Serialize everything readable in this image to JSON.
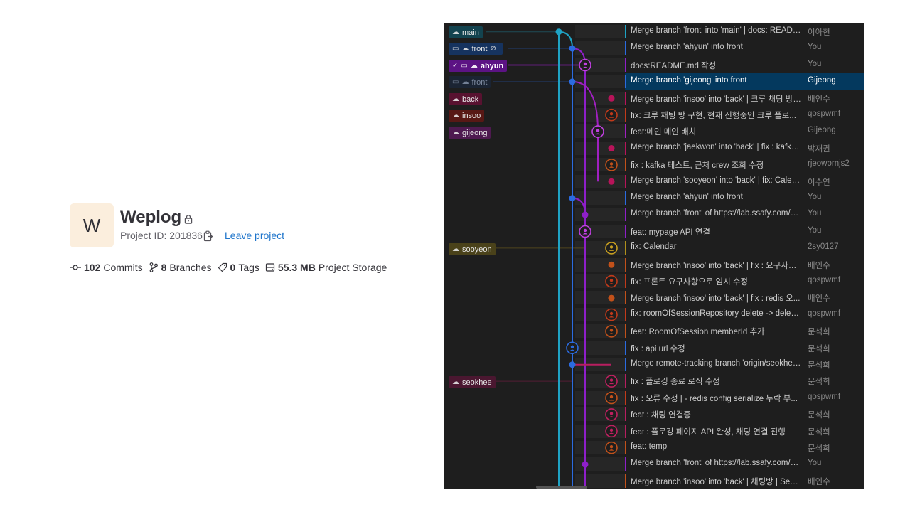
{
  "project": {
    "avatar_letter": "W",
    "name": "Weplog",
    "id_text": "Project ID: 201836",
    "leave_label": "Leave project"
  },
  "stats": {
    "commits_count": "102",
    "commits_label": "Commits",
    "branches_count": "8",
    "branches_label": "Branches",
    "tags_count": "0",
    "tags_label": "Tags",
    "storage_value": "55.3 MB",
    "storage_label": "Project Storage"
  },
  "colors": {
    "main": "#1fa3c4",
    "front": "#2b6be0",
    "ahyun": "#8e1fc9",
    "back": "#b8145a",
    "selected_row": "#04395e"
  },
  "branch_labels": {
    "main": "main",
    "front": "front",
    "ahyun": "ahyun",
    "front_remote": "front",
    "back": "back",
    "insoo": "insoo",
    "gijeong": "gijeong",
    "sooyeon": "sooyeon",
    "seokhee": "seokhee"
  },
  "commits": [
    {
      "message": "Merge branch 'front' into 'main' | docs: READM...",
      "author": "이아현"
    },
    {
      "message": "Merge branch 'ahyun' into front",
      "author": "You"
    },
    {
      "message": "docs:README.md 작성",
      "author": "You"
    },
    {
      "message": "Merge branch 'gijeong' into front",
      "author": "Gijeong"
    },
    {
      "message": "Merge branch 'insoo' into 'back' | 크루 채팅 방 ...",
      "author": "배인수"
    },
    {
      "message": "fix: 크루 채팅 방 구현, 현재 진행중인 크루 플로...",
      "author": "qospwmf"
    },
    {
      "message": "feat:메인 메인 배치",
      "author": "Gijeong"
    },
    {
      "message": "Merge branch 'jaekwon' into 'back' | fix : kafka ...",
      "author": "박재권"
    },
    {
      "message": "fix : kafka 테스트, 근처 crew 조회 수정",
      "author": "rjeowornjs2"
    },
    {
      "message": "Merge branch 'sooyeon' into 'back' | fix: Calend...",
      "author": "이수연"
    },
    {
      "message": "Merge branch 'ahyun' into front",
      "author": "You"
    },
    {
      "message": "Merge branch 'front' of https://lab.ssafy.com/s...",
      "author": "You"
    },
    {
      "message": "feat: mypage API 연결",
      "author": "You"
    },
    {
      "message": "fix: Calendar",
      "author": "2sy0127"
    },
    {
      "message": "Merge branch 'insoo' into 'back' | fix : 요구사항...",
      "author": "배인수"
    },
    {
      "message": "fix: 프론트 요구사항으로 임시 수정",
      "author": "qospwmf"
    },
    {
      "message": "Merge branch 'insoo' into 'back' | fix : redis 오...",
      "author": "배인수"
    },
    {
      "message": "fix: roomOfSessionRepository delete -> deleteB...",
      "author": "qospwmf"
    },
    {
      "message": "feat: RoomOfSession memberId 추가",
      "author": "문석희"
    },
    {
      "message": "fix : api url 수정",
      "author": "문석희"
    },
    {
      "message": "Merge remote-tracking branch 'origin/seokhee'...",
      "author": "문석희"
    },
    {
      "message": "fix : 플로깅 종료 로직 수정",
      "author": "문석희"
    },
    {
      "message": "fix : 오류 수정 | - redis config serialize 누락 부...",
      "author": "qospwmf"
    },
    {
      "message": "feat : 채팅 연결중",
      "author": "문석희"
    },
    {
      "message": "feat : 플로깅 페이지 API 완성, 채팅 연결 진행",
      "author": "문석희"
    },
    {
      "message": "feat: temp",
      "author": "문석희"
    },
    {
      "message": "Merge branch 'front' of https://lab.ssafy.com/s...",
      "author": "You"
    },
    {
      "message": "Merge branch 'insoo' into 'back' | 채팅방 | See ...",
      "author": "배인수"
    }
  ]
}
